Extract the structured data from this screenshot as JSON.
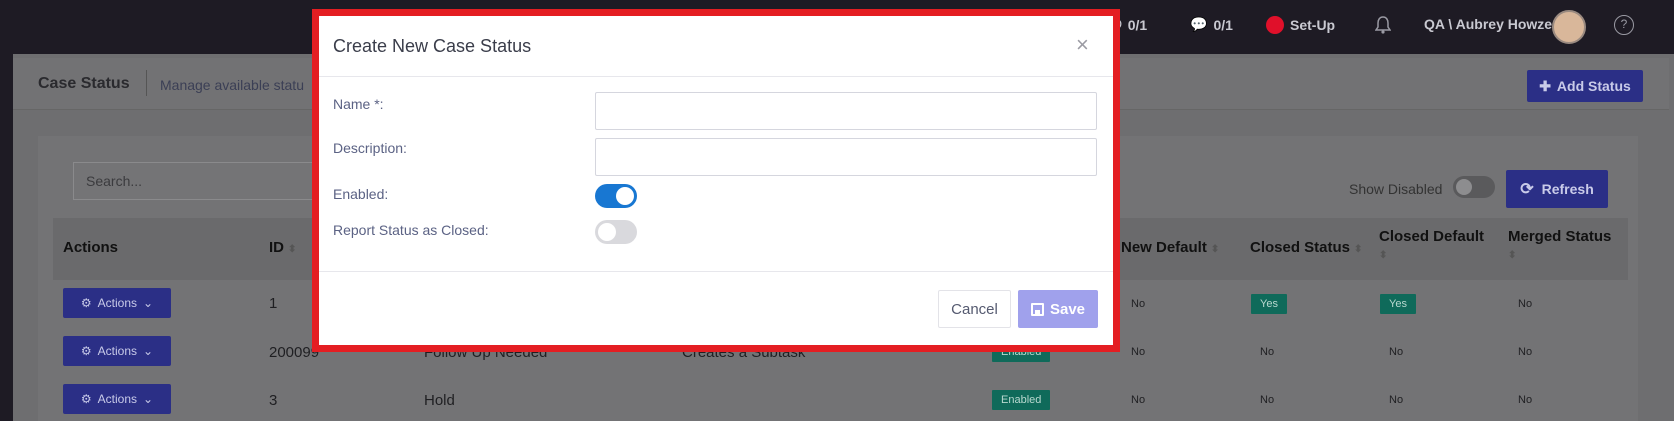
{
  "topbar": {
    "calls": "0/1",
    "sms": "0/1",
    "setup_label": "Set-Up",
    "user": "QA \\ Aubrey Howze",
    "help": "?"
  },
  "page": {
    "title": "Case Status",
    "subtitle": "Manage available statu",
    "add_button": "Add Status",
    "search_placeholder": "Search...",
    "show_disabled": "Show Disabled",
    "refresh_button": "Refresh"
  },
  "table": {
    "headers": {
      "actions": "Actions",
      "id": "ID",
      "new_default": "New Default",
      "closed_status": "Closed Status",
      "closed_default": "Closed Default",
      "merged_status": "Merged Status"
    },
    "action_label": "Actions",
    "rows": [
      {
        "id": "1",
        "name": "",
        "description": "",
        "enabled": "",
        "new_default": "No",
        "closed_status": "Yes",
        "closed_default": "Yes",
        "merged_status": "No"
      },
      {
        "id": "200099",
        "name": "Follow Up Needed",
        "description": "Creates a Subtask",
        "enabled": "Enabled",
        "new_default": "No",
        "closed_status": "No",
        "closed_default": "No",
        "merged_status": "No"
      },
      {
        "id": "3",
        "name": "Hold",
        "description": "",
        "enabled": "Enabled",
        "new_default": "No",
        "closed_status": "No",
        "closed_default": "No",
        "merged_status": "No"
      }
    ]
  },
  "modal": {
    "title": "Create New Case Status",
    "close": "×",
    "fields": {
      "name_label": "Name *:",
      "name_value": "",
      "description_label": "Description:",
      "description_value": "",
      "enabled_label": "Enabled:",
      "enabled_on": true,
      "closed_label": "Report Status as Closed:",
      "closed_on": false
    },
    "cancel": "Cancel",
    "save": "Save"
  },
  "colors": {
    "modal_outline": "#e41e22",
    "primary": "#2b2f86",
    "switch_on": "#1877d2",
    "save_disabled": "#a0a1ec",
    "badge_green": "#0f6a5a"
  },
  "icons": [
    "phone-icon",
    "sms-icon",
    "bell-icon",
    "avatar",
    "help-icon",
    "plus-icon",
    "refresh-icon",
    "gear-icon",
    "chevron-down-icon",
    "sort-icon",
    "close-icon",
    "save-icon"
  ]
}
